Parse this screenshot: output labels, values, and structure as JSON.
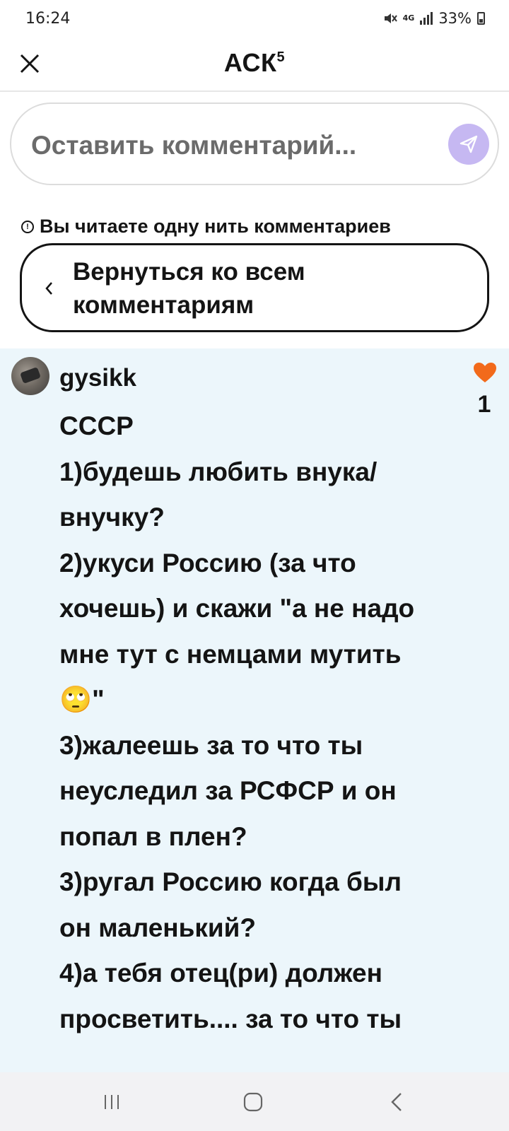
{
  "status_bar": {
    "time": "16:24",
    "network": "4G",
    "battery": "33%"
  },
  "header": {
    "title": "АСК",
    "title_sup": "5",
    "close_icon": "close-icon"
  },
  "comment_input": {
    "placeholder": "Оставить комментарий...",
    "send_icon": "send-icon",
    "send_color": "#c6b8f2"
  },
  "thread_notice": {
    "icon": "info-icon",
    "text": "Вы читаете одну нить комментариев"
  },
  "back_button": {
    "label": "Вернуться ко всем комментариям",
    "icon": "chevron-left-icon"
  },
  "comment": {
    "author": "gysikk",
    "text": "СССР\n1)будешь любить внука/\nвнучку?\n2)укуси Россию (за что\nхочешь) и скажи \"а не надо\nмне тут с немцами мутить\n🙄\"\n3)жалеешь за то что ты\nнеуследил за РСФСР и он\nпопал в плен?\n3)ругал Россию когда был\nон маленький?\n4)а тебя отец(ри) должен\nпросветить.... за то что ты",
    "likes": "1",
    "like_icon": "heart-icon",
    "like_color": "#f26a1b",
    "card_background": "#ecf6fb"
  },
  "nav_bar": {
    "recent_icon": "recent-apps-icon",
    "home_icon": "home-icon",
    "back_icon": "back-icon"
  }
}
